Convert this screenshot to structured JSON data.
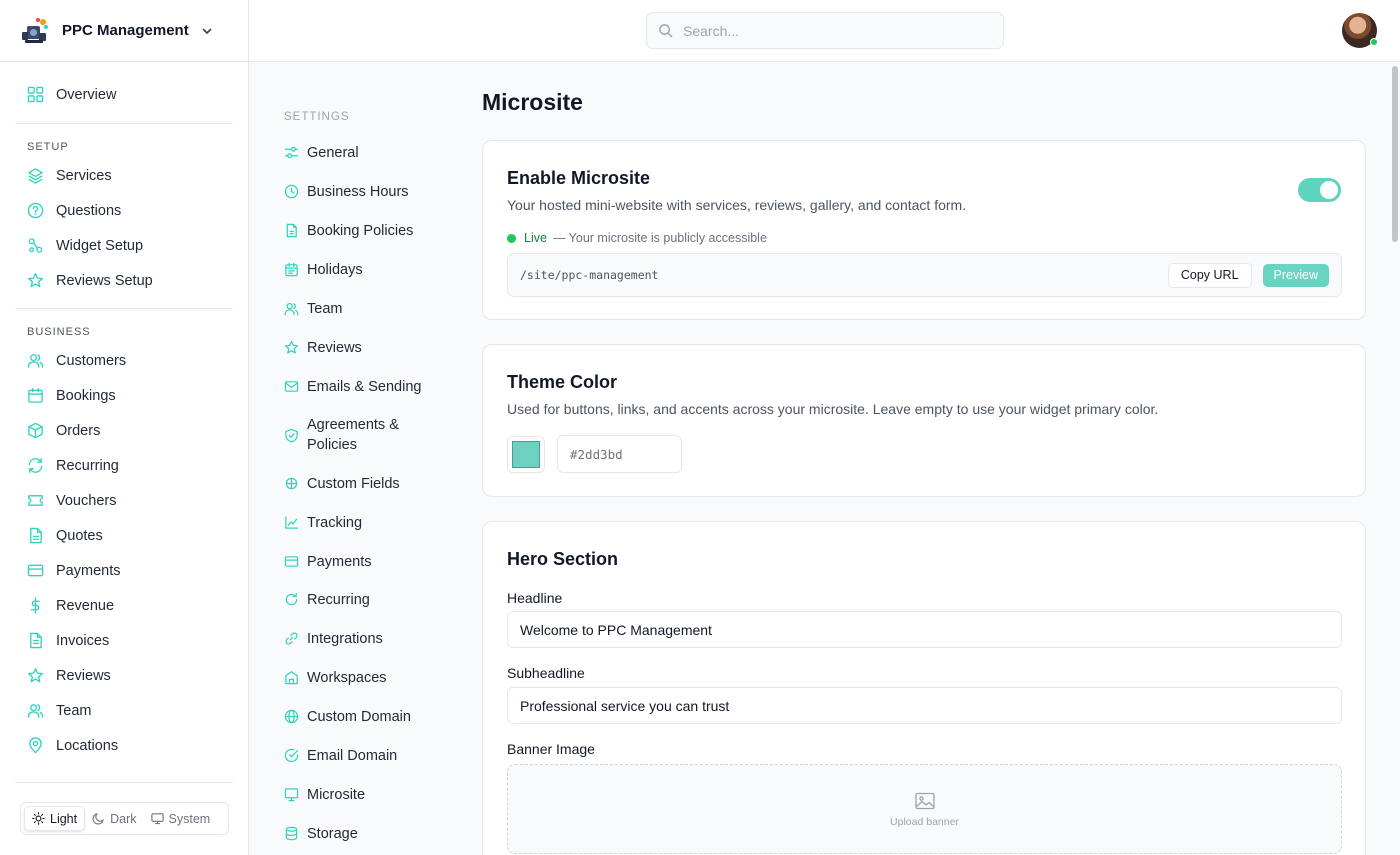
{
  "brand": {
    "name": "PPC Management"
  },
  "search": {
    "placeholder": "Search..."
  },
  "sidebar": {
    "overview": "Overview",
    "setup_heading": "SETUP",
    "setup": [
      "Services",
      "Questions",
      "Widget Setup",
      "Reviews Setup"
    ],
    "business_heading": "BUSINESS",
    "business": [
      "Customers",
      "Bookings",
      "Orders",
      "Recurring",
      "Vouchers",
      "Quotes",
      "Payments",
      "Revenue",
      "Invoices",
      "Reviews",
      "Team",
      "Locations"
    ],
    "theme": {
      "light": "Light",
      "dark": "Dark",
      "system": "System",
      "selected": "Light"
    }
  },
  "settings_nav": {
    "heading": "SETTINGS",
    "items": [
      "General",
      "Business Hours",
      "Booking Policies",
      "Holidays",
      "Team",
      "Reviews",
      "Emails & Sending",
      "Agreements & Policies",
      "Custom Fields",
      "Tracking",
      "Payments",
      "Recurring",
      "Integrations",
      "Workspaces",
      "Custom Domain",
      "Email Domain",
      "Microsite",
      "Storage"
    ]
  },
  "main": {
    "title": "Microsite",
    "enable": {
      "title": "Enable Microsite",
      "description": "Your hosted mini-website with services, reviews, gallery, and contact form.",
      "enabled": true,
      "status_label": "Live",
      "status_note": "— Your microsite is publicly accessible",
      "url": "/site/ppc-management",
      "copy_label": "Copy URL",
      "preview_label": "Preview"
    },
    "theme_color": {
      "title": "Theme Color",
      "description": "Used for buttons, links, and accents across your microsite. Leave empty to use your widget primary color.",
      "placeholder": "#2dd3bd",
      "swatch_color": "#6dd0c0"
    },
    "hero": {
      "title": "Hero Section",
      "headline_label": "Headline",
      "headline_value": "Welcome to PPC Management",
      "subheadline_label": "Subheadline",
      "subheadline_value": "Professional service you can trust",
      "banner_label": "Banner Image",
      "upload_label": "Upload banner"
    }
  },
  "colors": {
    "accent": "#2dd3bd",
    "live": "#22c55e"
  }
}
